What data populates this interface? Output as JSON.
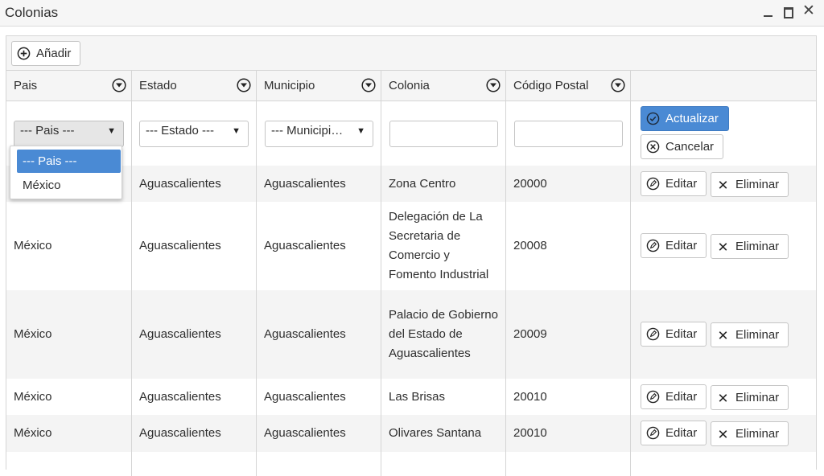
{
  "window": {
    "title": "Colonias"
  },
  "toolbar": {
    "add_label": "Añadir"
  },
  "columns": [
    "Pais",
    "Estado",
    "Municipio",
    "Colonia",
    "Código Postal"
  ],
  "edit_row": {
    "pais_value": "--- Pais ---",
    "estado_value": "--- Estado ---",
    "municipio_value": "--- Municipio ---",
    "colonia_value": "",
    "cp_value": "",
    "update_label": "Actualizar",
    "cancel_label": "Cancelar"
  },
  "pais_dropdown": {
    "options": [
      "--- Pais ---",
      "México"
    ],
    "selected": "--- Pais ---"
  },
  "actions": {
    "edit_label": "Editar",
    "delete_label": "Eliminar"
  },
  "rows": [
    [
      "",
      "Aguascalientes",
      "Aguascalientes",
      "Zona Centro",
      "20000"
    ],
    [
      "México",
      "Aguascalientes",
      "Aguascalientes",
      "Delegación de La Secretaria de Comercio y Fomento Industrial",
      "20008"
    ],
    [
      "México",
      "Aguascalientes",
      "Aguascalientes",
      "Palacio de Gobierno del Estado de Aguascalientes",
      "20009"
    ],
    [
      "México",
      "Aguascalientes",
      "Aguascalientes",
      "Las Brisas",
      "20010"
    ],
    [
      "México",
      "Aguascalientes",
      "Aguascalientes",
      "Olivares Santana",
      "20010"
    ]
  ]
}
